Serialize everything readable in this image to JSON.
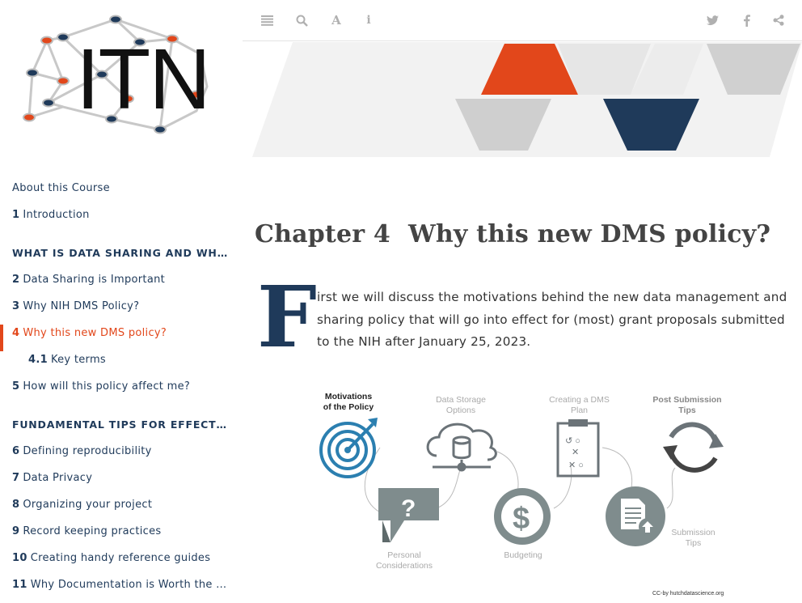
{
  "logo": {
    "text": "ITN"
  },
  "toolbar": {
    "left_icons": [
      "menu-icon",
      "search-icon",
      "font-icon",
      "info-icon"
    ],
    "right_icons": [
      "twitter-icon",
      "facebook-icon",
      "share-icon"
    ]
  },
  "sidebar": {
    "items": [
      {
        "num": "",
        "label": "About this Course"
      },
      {
        "num": "1",
        "label": "Introduction"
      },
      {
        "part": "WHAT IS DATA SHARING AND WHY IS I…"
      },
      {
        "num": "2",
        "label": "Data Sharing is Important"
      },
      {
        "num": "3",
        "label": "Why NIH DMS Policy?"
      },
      {
        "num": "4",
        "label": "Why this new DMS policy?",
        "active": true
      },
      {
        "num": "4.1",
        "label": "Key terms",
        "sub": true
      },
      {
        "num": "5",
        "label": "How will this policy affect me?"
      },
      {
        "part": "FUNDAMENTAL TIPS FOR EFFECTIVE D…"
      },
      {
        "num": "6",
        "label": "Defining reproducibility"
      },
      {
        "num": "7",
        "label": "Data Privacy"
      },
      {
        "num": "8",
        "label": "Organizing your project"
      },
      {
        "num": "9",
        "label": "Record keeping practices"
      },
      {
        "num": "10",
        "label": "Creating handy reference guides"
      },
      {
        "num": "11",
        "label": "Why Documentation is Worth the Time"
      }
    ]
  },
  "main": {
    "chapter_number": "Chapter 4",
    "chapter_title": "Why this new DMS policy?",
    "dropcap": "F",
    "intro": "irst we will discuss the motivations behind the new data management and sharing policy that will go into effect for (most) grant proposals submitted to the NIH after January 25, 2023."
  },
  "figure": {
    "labels": {
      "motivations": "Motivations\nof the Policy",
      "storage": "Data Storage\nOptions",
      "creating": "Creating a DMS\nPlan",
      "post": "Post Submission\nTips",
      "personal": "Personal\nConsiderations",
      "budgeting": "Budgeting",
      "submission": "Submission\nTips"
    },
    "credit": "CC-by hutchdatascience.org"
  },
  "colors": {
    "accent": "#e2471b",
    "navy": "#1f3a5a",
    "gray": "#7f8c8d"
  }
}
